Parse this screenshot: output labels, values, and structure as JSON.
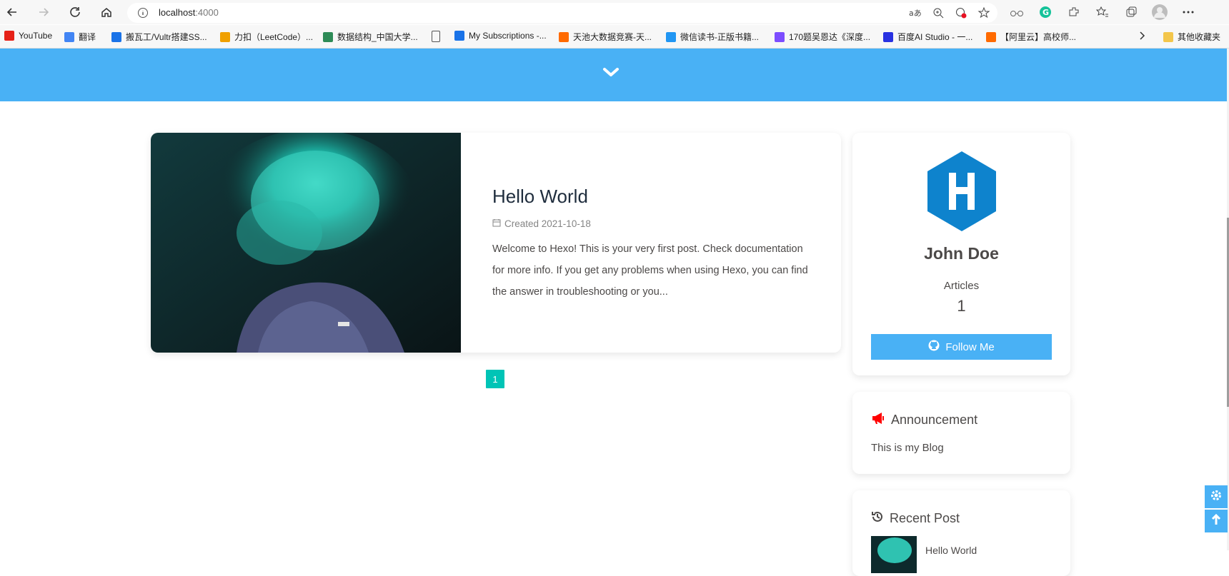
{
  "browser": {
    "url_host": "localhost",
    "url_port": ":4000",
    "bookmarks": [
      {
        "label": "YouTube",
        "color": "#e62117"
      },
      {
        "label": "翻译",
        "color": "#4285f4"
      },
      {
        "label": "搬瓦工/Vultr搭建SS...",
        "color": "#1a73e8"
      },
      {
        "label": "力扣（LeetCode）...",
        "color": "#f0a000"
      },
      {
        "label": "数据结构_中国大学...",
        "color": "#2e8b57"
      },
      {
        "label": "",
        "color": "#ffffff"
      },
      {
        "label": "My Subscriptions -...",
        "color": "#1a73e8"
      },
      {
        "label": "天池大数据竞赛-天...",
        "color": "#ff6a00"
      },
      {
        "label": "微信读书-正版书籍...",
        "color": "#2196f3"
      },
      {
        "label": "170题吴恩达《深度...",
        "color": "#7c4dff"
      },
      {
        "label": "百度AI Studio - 一...",
        "color": "#2932e1"
      },
      {
        "label": "【阿里云】高校师...",
        "color": "#ff6a00"
      }
    ],
    "other_bookmarks": "其他收藏夹"
  },
  "post": {
    "title": "Hello World",
    "meta": "Created 2021-10-18",
    "excerpt": "Welcome to Hexo! This is your very first post. Check documentation for more info. If you get any problems when using Hexo, you can find the answer in troubleshooting or you..."
  },
  "pagination": {
    "current": "1"
  },
  "author": {
    "name": "John Doe",
    "articles_label": "Articles",
    "articles_count": "1",
    "follow_label": "Follow Me"
  },
  "announcement": {
    "title": "Announcement",
    "text": "This is my Blog"
  },
  "recent": {
    "title": "Recent Post",
    "items": [
      {
        "title": "Hello World"
      }
    ]
  },
  "colors": {
    "accent": "#49b1f5",
    "pager": "#00c4b6",
    "announce_icon": "#ff0000"
  }
}
